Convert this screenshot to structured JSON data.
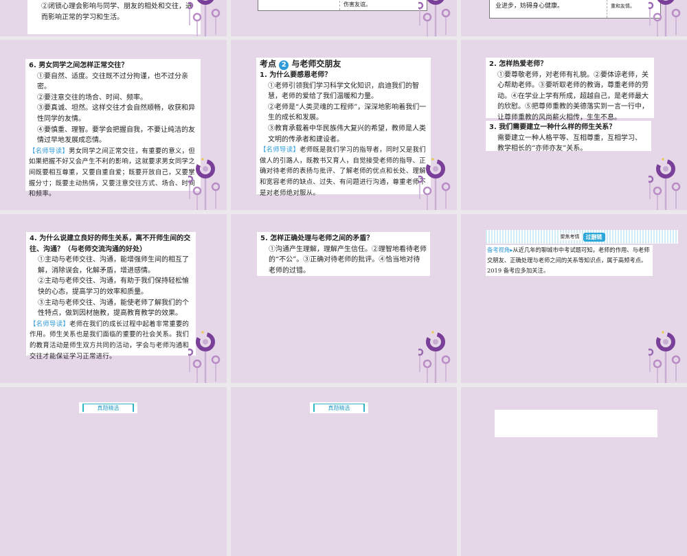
{
  "slides": {
    "s1": {
      "lines": [
        "②闭锁心理会影响与同学、朋友的相处和交往，进",
        "而影响正常的学习和生活。"
      ]
    },
    "s2": {
      "cell": "伤害友谊。"
    },
    "s3": {
      "left": "业进步，妨碍身心健康。",
      "right": "重和友情。"
    },
    "s4": {
      "question": "6. 男女同学之间怎样正常交往？",
      "items": [
        "①要自然、适度。交往既不过分拘谨，也不过分亲密。",
        "②要注意交往的场合、时间、频率。",
        "③要真诚、坦然。这样交往才会自然顺畅，收获和异性同学的友情。",
        "④要慎重、理智。要学会把握自我，不要让纯洁的友情过早地发展成恋情。"
      ],
      "guide_tag": "【名师导读】",
      "guide": "男女同学之间正常交往，有重要的意义，但如果把握不好又会产生不利的影响，这就要求男女同学之间既要相互尊重，又要自重自爱；既要开放自己，又要掌握分寸；既要主动热情，又要注意交往方式、场合、时间和频率。"
    },
    "s5": {
      "heading_pre": "考点",
      "heading_num": "2",
      "heading": "与老师交朋友",
      "question": "1. 为什么要感恩老师？",
      "items": [
        "①老师引领我们学习科学文化知识，启迪我们的智慧，老师的爱给了我们温暖和力量。",
        "②老师是“人类灵魂的工程师”，深深地影响着我们一生的成长和发展。",
        "③教育承载着中华民族伟大复兴的希望，教师是人类文明的传承者和建设者。"
      ],
      "guide_tag": "【名师导读】",
      "guide": "老师既是我们学习的指导者，同时又是我们做人的引路人，既教书又育人，自觉接受老师的指导、正确对待老师的表扬与批评、了解老师的优点和长处、理解和宽容老师的缺点、过失、有问题进行沟通，尊重老师不是对老师绝对服从。"
    },
    "s6": {
      "q2": "2. 怎样热爱老师？",
      "a2": "①要尊敬老师，对老师有礼貌。②要体谅老师，关心帮助老师。③要听取老师的教诲，尊重老师的劳动。④在学业上学有所成，超越自己，是老师最大的欣慰。⑤把尊师重教的美德落实到一言一行中，让尊师重教的风尚薪火相传，生生不息。",
      "q3": "3. 我们需要建立一种什么样的师生关系？",
      "a3": "需要建立一种人格平等、互相尊重，互相学习、教学相长的“亦师亦友”关系。"
    },
    "s7": {
      "question": "4. 为什么说建立良好的师生关系，离不开师生间的交往、沟通？（与老师交流沟通的好处）",
      "items": [
        "①主动与老师交往、沟通，能增强师生间的相互了解，消除误会，化解矛盾，增进感情。",
        "②主动与老师交往、沟通，有助于我们保持轻松愉快的心态，提高学习的效率和质量。",
        "③主动与老师交往、沟通，能使老师了解我们的个性特点，做到因材施教，提高教育教学的效果。"
      ],
      "guide_tag": "【名师导读】",
      "guide": "老师在我们的成长过程中起着非常重要的作用。师生关系也是我们面临的重要的社会关系。我们的教育活动是师生双方共同的活动，学会与老师沟通和交往才能保证学习正常进行。"
    },
    "s8": {
      "question": "5. 怎样正确处理与老师之间的矛盾？",
      "answer": "①沟通产生理解，理解产生信任。②理智地看待老师的“不公”。③正确对待老师的批评。④恰当地对待老师的过错。"
    },
    "s9": {
      "banner_label": "聚焦考情",
      "banner_pill": "过删链",
      "tag": "备考视角▸",
      "text": "从近几年的聊城市中考试题可知，老师的作用、与老师交朋友、正确处理与老师之间的关系等知识点，属于高频考点。2019 备考应多加关注。"
    },
    "s10": {
      "label": "真题精选"
    },
    "s11": {
      "label": "真题精选"
    }
  },
  "colors": {
    "slide_bg": "#e5d7e8",
    "accent_blue": "#2f9ad8",
    "deco_purple": "#7a3f98"
  }
}
